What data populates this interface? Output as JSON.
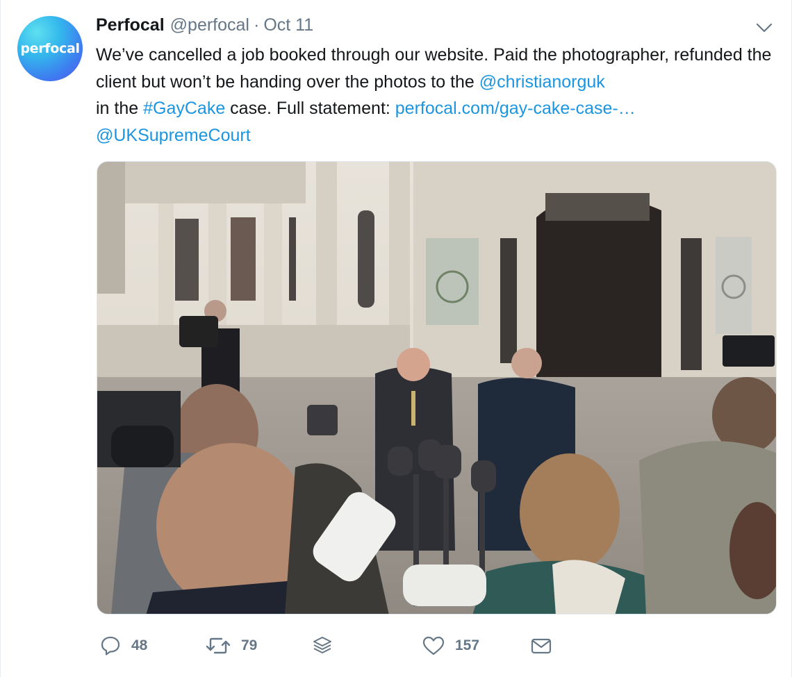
{
  "tweet": {
    "avatar_text": "perfocal",
    "name": "Perfocal",
    "handle": "@perfocal",
    "separator": "·",
    "date": "Oct 11",
    "text": {
      "p1": "We’ve cancelled a job booked through our website. Paid the photographer, refunded the client but won’t be handing over the photos to the ",
      "mention1": "@christianorguk",
      "p2": " in the ",
      "hashtag": "#GayCake",
      "p3": " case. Full statement: ",
      "url": "perfocal.com/gay-cake-case-…",
      "mention2": "@UKSupremeCourt"
    },
    "actions": {
      "replies": "48",
      "retweets": "79",
      "likes": "157"
    }
  },
  "icons": {
    "caret": "chevron-down-icon",
    "reply": "speech-bubble-icon",
    "retweet": "retweet-arrows-icon",
    "stack": "layers-icon",
    "like": "heart-icon",
    "dm": "envelope-icon"
  },
  "colors": {
    "link": "#1b95e0",
    "muted": "#657786",
    "text": "#14171a"
  }
}
